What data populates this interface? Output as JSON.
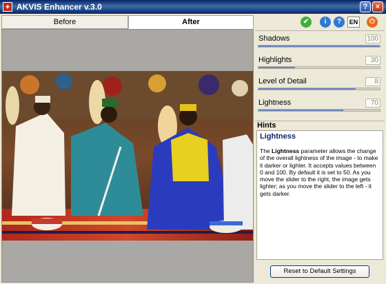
{
  "window": {
    "title": "AKVIS Enhancer v.3.0",
    "logo_glyph": "✦",
    "help_glyph": "?",
    "close_glyph": "×"
  },
  "view_tabs": {
    "before": "Before",
    "after": "After",
    "active": "After"
  },
  "toolbar": {
    "ok_glyph": "✔",
    "info_glyph": "i",
    "help_glyph": "?",
    "language": "EN",
    "power_glyph": "⏻"
  },
  "colors": {
    "titlebar": "#0a246a",
    "panel": "#ece9d8",
    "slider_fill": "#6a84c4",
    "hint_title": "#0a246a"
  },
  "parameters": [
    {
      "label": "Shadows",
      "value": "100",
      "max": 100
    },
    {
      "label": "Highlights",
      "value": "30",
      "max": 100
    },
    {
      "label": "Level of Detail",
      "value": "8",
      "max": 10
    },
    {
      "label": "Lightness",
      "value": "70",
      "max": 100
    }
  ],
  "hints": {
    "header": "Hints",
    "title": "Lightness",
    "text_prefix": "The ",
    "text_bold": "Lightness",
    "text_body": " parameter allows the change of the overall lightness of the image - to make it darker or lighter. It accepts values between 0 and 100. By default it is set to 50. As you move the slider to the right, the image gets lighter; as you move the slider to the left - it gets darker."
  },
  "reset_button": "Reset to Default Settings"
}
